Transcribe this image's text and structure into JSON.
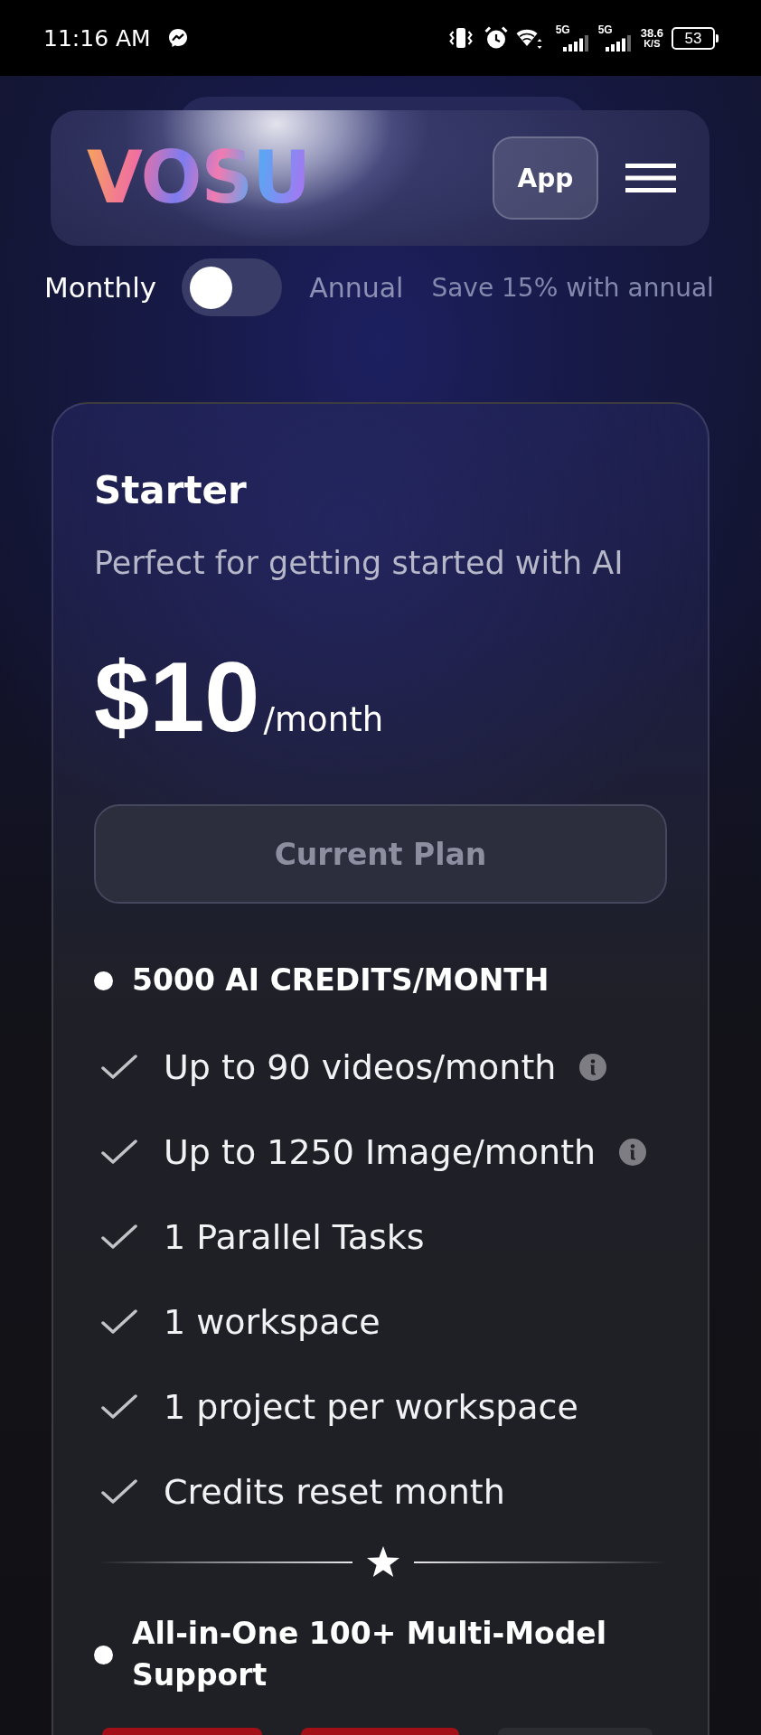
{
  "status_bar": {
    "time": "11:16 AM",
    "networks": [
      {
        "type": "5G"
      },
      {
        "type": "5G"
      }
    ],
    "speed": "38.6",
    "speed_unit": "K/S",
    "battery": "53"
  },
  "header": {
    "logo": "VOSU",
    "app_button": "App"
  },
  "billing_toggle": {
    "monthly_label": "Monthly",
    "on": false,
    "annual_label": "Annual",
    "savings_note": "Save 15% with annual"
  },
  "plan": {
    "name": "Starter",
    "description": "Perfect for getting started with AI",
    "price": "$10",
    "period": "/month",
    "button": {
      "label": "Current Plan",
      "disabled": true
    },
    "credits": "5000 AI CREDITS/MONTH",
    "features": [
      {
        "text": "Up to 90 videos/month",
        "info": true
      },
      {
        "text": "Up to 1250 Image/month",
        "info": true
      },
      {
        "text": "1 Parallel Tasks",
        "info": false
      },
      {
        "text": "1 workspace",
        "info": false
      },
      {
        "text": "1 project per workspace",
        "info": false
      },
      {
        "text": "Credits reset month",
        "info": false
      }
    ],
    "highlight": "All-in-One 100+ Multi-Model Support",
    "model_tags": [
      {
        "color": "#a30f17"
      },
      {
        "color": "#a30f17"
      },
      {
        "color": "#2c2d33"
      }
    ]
  }
}
